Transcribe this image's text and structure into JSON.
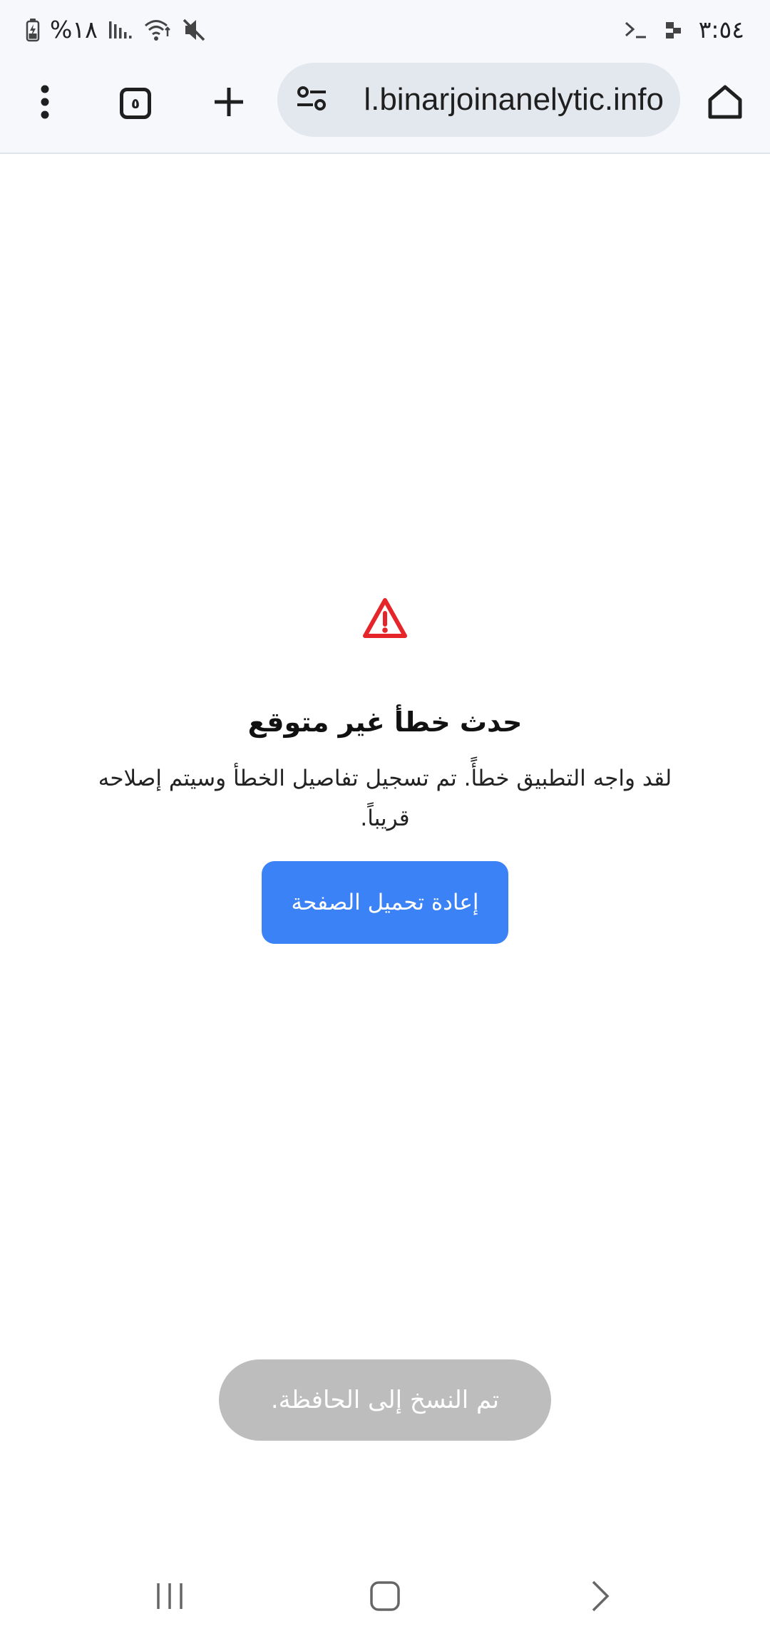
{
  "status_bar": {
    "time": "٣:٥٤",
    "battery_percent": "%١٨",
    "icons": [
      "terminal-icon",
      "notification-dots-icon",
      "battery-icon",
      "signal-icon",
      "wifi-icon",
      "mute-icon"
    ]
  },
  "browser": {
    "url": "l.binarjoinanelytic.info",
    "tab_count": "٥",
    "icons": [
      "menu-dots-icon",
      "tabs-icon",
      "new-tab-plus-icon",
      "site-settings-icon",
      "home-icon"
    ]
  },
  "error": {
    "icon": "warning-triangle-icon",
    "title": "حدث خطأ غير متوقع",
    "message": "لقد واجه التطبيق خطأً. تم تسجيل تفاصيل الخطأ وسيتم إصلاحه قريباً.",
    "reload_label": "إعادة تحميل الصفحة",
    "accent_color": "#3b82f6",
    "icon_color": "#e5252a"
  },
  "toast": {
    "text": "تم النسخ إلى الحافظة."
  },
  "nav_bar": {
    "icons": [
      "recents-icon",
      "home-square-icon",
      "back-chevron-icon"
    ]
  }
}
